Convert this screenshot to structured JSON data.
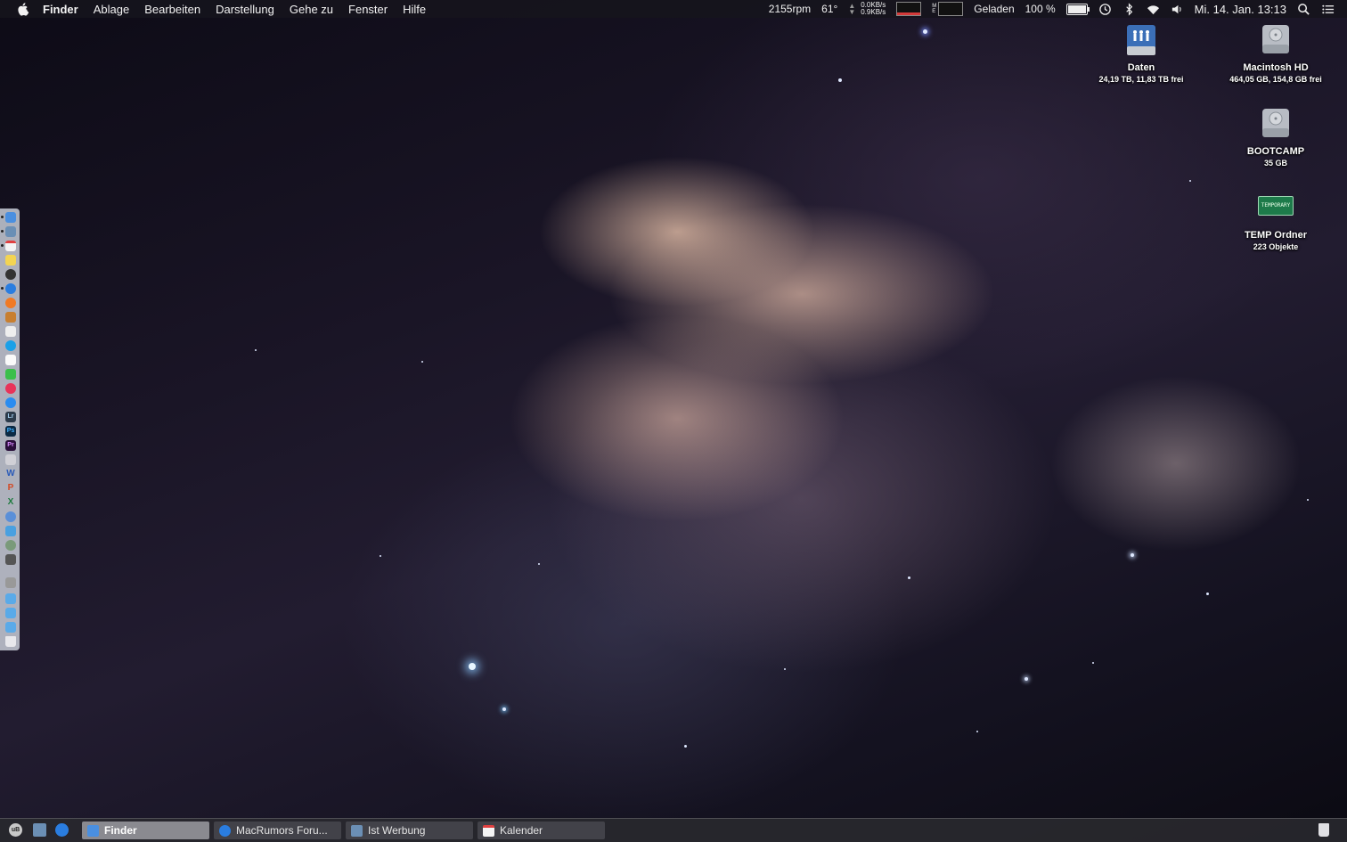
{
  "menubar": {
    "app_name": "Finder",
    "menus": [
      "Ablage",
      "Bearbeiten",
      "Darstellung",
      "Gehe zu",
      "Fenster",
      "Hilfe"
    ],
    "fan_speed": "2155rpm",
    "temperature": "61°",
    "net_up": "0.0KB/s",
    "net_down": "0.9KB/s",
    "battery_status": "Geladen",
    "battery_percent": "100 %",
    "battery_level": 1.0,
    "datetime": "Mi. 14. Jan. 13:13"
  },
  "desktop": {
    "items": [
      {
        "name": "Daten",
        "sub": "24,19 TB, 11,83 TB frei",
        "icon": "network-drive-icon"
      },
      {
        "name": "Macintosh HD",
        "sub": "464,05 GB, 154,8 GB frei",
        "icon": "hard-drive-icon"
      },
      {
        "name": "BOOTCAMP",
        "sub": "35 GB",
        "icon": "hard-drive-icon"
      },
      {
        "name": "TEMP Ordner",
        "sub": "223 Objekte",
        "icon": "temporary-folder-icon",
        "badge": "TEMPORARY"
      }
    ]
  },
  "dock": {
    "apps": [
      "finder-icon",
      "preview-icon",
      "calendar-icon",
      "notes-icon",
      "activity-icon",
      "safari-icon",
      "firefox-icon",
      "books-icon",
      "reminders-icon",
      "skype-icon",
      "textedit-icon",
      "messages-icon",
      "itunes-icon",
      "appstore-icon",
      "lightroom-icon",
      "photoshop-icon",
      "premiere-icon",
      "photos-icon",
      "word-icon",
      "powerpoint-icon",
      "excel-icon",
      "network-icon",
      "sync-icon",
      "maps-icon",
      "camera-icon",
      "link-icon",
      "folder-icon",
      "folder-icon",
      "downloads-icon",
      "trash-icon"
    ],
    "labels": {
      "lightroom": "Lr",
      "photoshop": "Ps",
      "premiere": "Pr",
      "word": "W",
      "powerpoint": "P",
      "excel": "X"
    }
  },
  "taskbar": {
    "tasks": [
      {
        "label": "Finder",
        "active": true
      },
      {
        "label": "MacRumors Foru...",
        "active": false
      },
      {
        "label": "Ist Werbung",
        "active": false
      },
      {
        "label": "Kalender",
        "active": false
      }
    ],
    "ub_label": "uB"
  }
}
